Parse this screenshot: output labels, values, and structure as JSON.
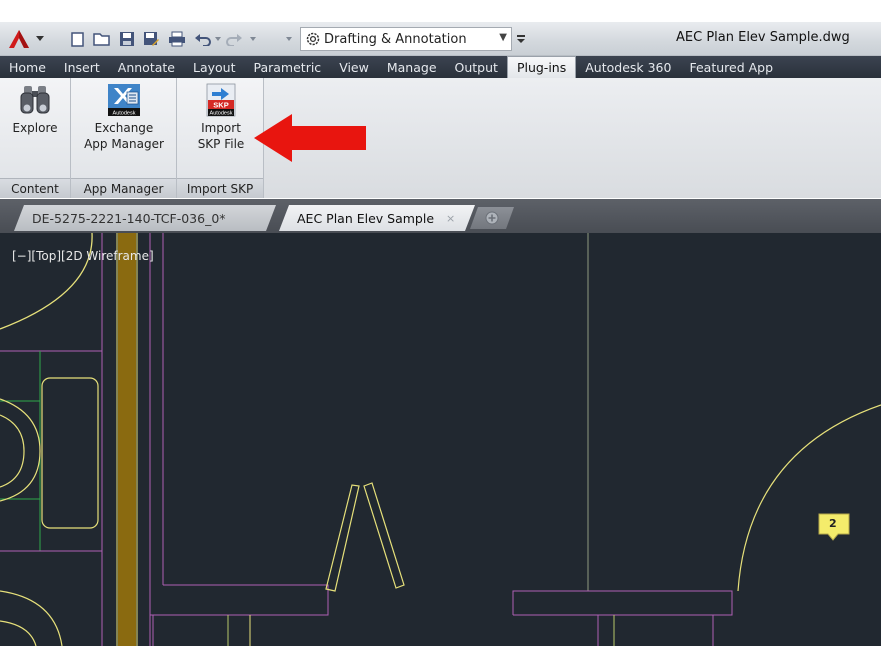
{
  "window": {
    "workspace": "Drafting & Annotation",
    "document_title": "AEC Plan Elev Sample.dwg"
  },
  "quick_access": [
    "new-icon",
    "open-icon",
    "save-icon",
    "save-as-icon",
    "plot-icon",
    "undo-icon",
    "redo-icon"
  ],
  "ribbon_tabs": [
    {
      "label": "Home"
    },
    {
      "label": "Insert"
    },
    {
      "label": "Annotate"
    },
    {
      "label": "Layout"
    },
    {
      "label": "Parametric"
    },
    {
      "label": "View"
    },
    {
      "label": "Manage"
    },
    {
      "label": "Output"
    },
    {
      "label": "Plug-ins",
      "active": true
    },
    {
      "label": "Autodesk 360"
    },
    {
      "label": "Featured App"
    }
  ],
  "panels": {
    "content": {
      "label": "Content",
      "button": {
        "line1": "Explore",
        "icon": "binoculars-icon"
      }
    },
    "app_manager": {
      "label": "App Manager",
      "button": {
        "line1": "Exchange",
        "line2": "App Manager",
        "icon": "exchange-app-icon",
        "badge": "Autodesk"
      }
    },
    "import_skp": {
      "label": "Import SKP",
      "button": {
        "line1": "Import",
        "line2": "SKP File",
        "icon": "skp-import-icon",
        "badge_top": "SKP",
        "badge": "Autodesk"
      }
    }
  },
  "file_tabs": [
    {
      "label": "DE-5275-2221-140-TCF-036_0*",
      "active": false
    },
    {
      "label": "AEC Plan Elev Sample",
      "active": true,
      "close": "×"
    }
  ],
  "viewport": {
    "label": "[−][Top][2D Wireframe]",
    "marker": "2"
  },
  "colors": {
    "tab_bar": "#2a313b",
    "canvas": "#212830",
    "drawing_yellow": "#e6e07a",
    "drawing_magenta": "#b05fb5",
    "drawing_green": "#2fa84a",
    "wall_brown": "#8a6a10",
    "annotation_red": "#e8150f"
  }
}
